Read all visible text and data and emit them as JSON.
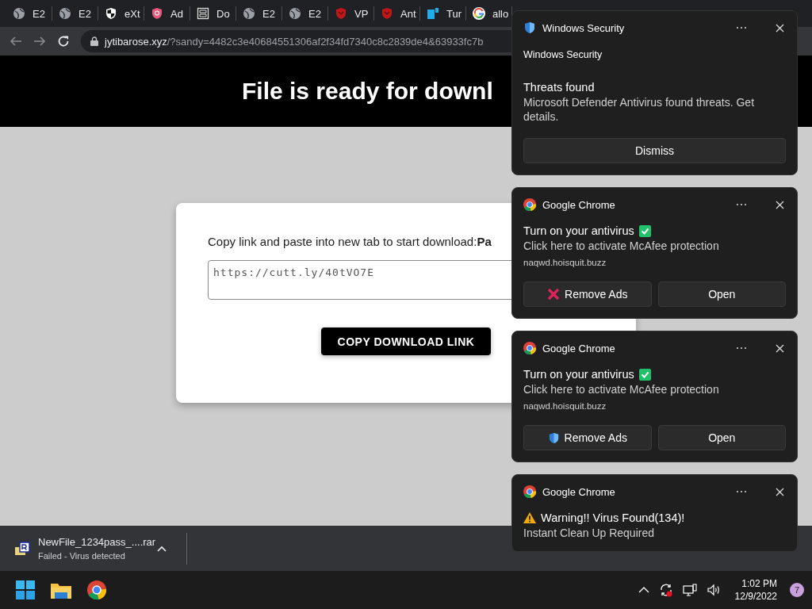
{
  "browser": {
    "tabs": [
      {
        "label": "E2",
        "kind": "globe"
      },
      {
        "label": "E2",
        "kind": "globe"
      },
      {
        "label": "eXt",
        "kind": "shield-mono"
      },
      {
        "label": "Ad",
        "kind": "shield-pink"
      },
      {
        "label": "Do",
        "kind": "document"
      },
      {
        "label": "E2",
        "kind": "globe"
      },
      {
        "label": "E2",
        "kind": "globe"
      },
      {
        "label": "VP",
        "kind": "shield-red"
      },
      {
        "label": "Ant",
        "kind": "shield-red"
      },
      {
        "label": "Tur",
        "kind": "tiles"
      },
      {
        "label": "allo",
        "kind": "ring"
      }
    ],
    "address_bar": {
      "host": "jytibarose.xyz",
      "path": "/?sandy=4482c3e40684551306af2f34fd7340c8c2839de4&63933fc7b"
    }
  },
  "page": {
    "heading": "File is ready for downl",
    "instruction": "Copy link and paste into new tab to start download:**Pa**",
    "link_field": {
      "value": "https://cutt.ly/40tVO7E"
    },
    "button": "COPY DOWNLOAD LINK"
  },
  "download_bar": {
    "file_name": "NewFile_1234pass_....rar",
    "status": "Failed - Virus detected"
  },
  "notifications": [
    {
      "kind": "security",
      "app": "Windows Security",
      "heading": "Windows Security",
      "title": "Threats found",
      "body": "Microsoft Defender Antivirus found threats. Get details.",
      "buttons": [
        {
          "label": "Dismiss",
          "kind": "plain"
        }
      ]
    },
    {
      "kind": "antivirus",
      "app": "Google Chrome",
      "title": "Turn on your antivirus",
      "body": "Click here to activate McAfee protection",
      "source": "naqwd.hoisquit.buzz",
      "buttons": [
        {
          "label": "Remove Ads",
          "kind": "cross"
        },
        {
          "label": "Open",
          "kind": "plain"
        }
      ]
    },
    {
      "kind": "antivirus",
      "app": "Google Chrome",
      "title": "Turn on your antivirus",
      "body": "Click here to activate McAfee protection",
      "source": "naqwd.hoisquit.buzz",
      "buttons": [
        {
          "label": "Remove Ads",
          "kind": "shield"
        },
        {
          "label": "Open",
          "kind": "plain"
        }
      ]
    },
    {
      "kind": "warning",
      "app": "Google Chrome",
      "title": "Warning!! Virus Found(134)!",
      "body": "Instant Clean Up Required"
    }
  ],
  "taskbar": {
    "time": "1:02 PM",
    "date": "12/9/2022",
    "notification_count": "7"
  }
}
